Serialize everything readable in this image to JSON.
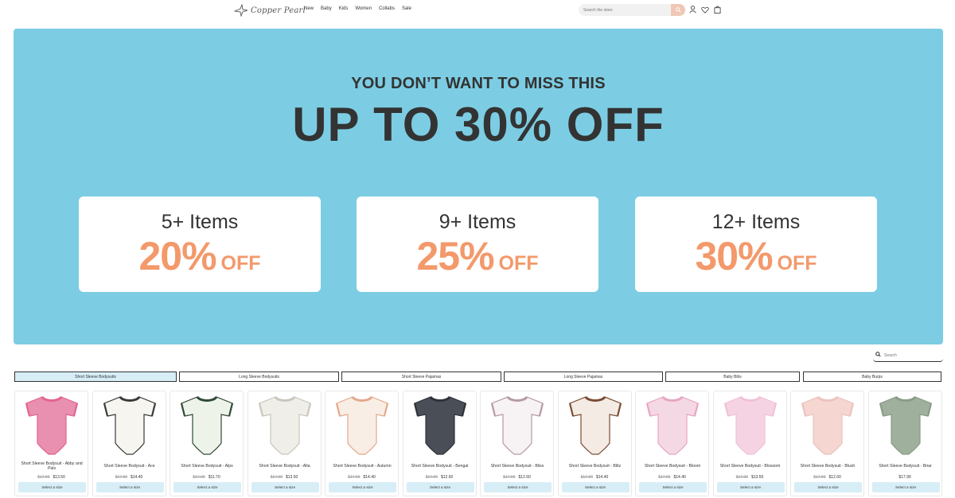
{
  "header": {
    "logo_text": "Copper Pearl",
    "nav": [
      "New",
      "Baby",
      "Kids",
      "Women",
      "Collabs",
      "Sale"
    ],
    "search_placeholder": "Search the store"
  },
  "hero": {
    "kicker": "YOU DON’T WANT TO MISS THIS",
    "headline": "UP TO 30% OFF",
    "tiers": [
      {
        "items": "5+ Items",
        "percent": "20%",
        "off": "OFF"
      },
      {
        "items": "9+ Items",
        "percent": "25%",
        "off": "OFF"
      },
      {
        "items": "12+ Items",
        "percent": "30%",
        "off": "OFF"
      }
    ],
    "background_color": "#7ccde3",
    "discount_color": "#f3996b"
  },
  "product_search": {
    "placeholder": "Search"
  },
  "tabs": [
    {
      "label": "Short Sleeve Bodysuits",
      "active": true
    },
    {
      "label": "Long Sleeve Bodysuits",
      "active": false
    },
    {
      "label": "Short Sleeve Pajamas",
      "active": false
    },
    {
      "label": "Long Sleeve Pajamas",
      "active": false
    },
    {
      "label": "Baby Bibs",
      "active": false
    },
    {
      "label": "Baby Burps",
      "active": false
    }
  ],
  "products": [
    {
      "name": "Short Sleeve Bodysuit - Abby and Pals",
      "old_price": "$17.99",
      "price": "$13.50",
      "button": "Select a size",
      "color": "#e98fb0",
      "trim": "#e2648f"
    },
    {
      "name": "Short Sleeve Bodysuit - Ace",
      "old_price": "$17.99",
      "price": "$14.40",
      "button": "Select a size",
      "color": "#f7f5f0",
      "trim": "#3a3a3a"
    },
    {
      "name": "Short Sleeve Bodysuit - Alps",
      "old_price": "$17.99",
      "price": "$11.70",
      "button": "Select a size",
      "color": "#eef3ea",
      "trim": "#2f4a35"
    },
    {
      "name": "Short Sleeve Bodysuit - Alta",
      "old_price": "$17.99",
      "price": "$13.50",
      "button": "Select a size",
      "color": "#efeee8",
      "trim": "#c9c6bb"
    },
    {
      "name": "Short Sleeve Bodysuit - Autumn",
      "old_price": "$17.99",
      "price": "$14.40",
      "button": "Select a size",
      "color": "#f8eee6",
      "trim": "#e3a98a"
    },
    {
      "name": "Short Sleeve Bodysuit - Bengal",
      "old_price": "$17.99",
      "price": "$12.60",
      "button": "Select a size",
      "color": "#4a4f57",
      "trim": "#2e3238"
    },
    {
      "name": "Short Sleeve Bodysuit - Bliss",
      "old_price": "$17.99",
      "price": "$12.60",
      "button": "Select a size",
      "color": "#f7f2f4",
      "trim": "#b59aa4"
    },
    {
      "name": "Short Sleeve Bodysuit - Blitz",
      "old_price": "$17.99",
      "price": "$14.40",
      "button": "Select a size",
      "color": "#f3ebe4",
      "trim": "#7b4d33"
    },
    {
      "name": "Short Sleeve Bodysuit - Bloom",
      "old_price": "$17.99",
      "price": "$14.40",
      "button": "Select a size",
      "color": "#f4d9e4",
      "trim": "#e8a5c1"
    },
    {
      "name": "Short Sleeve Bodysuit - Blossom",
      "old_price": "$17.99",
      "price": "$13.50",
      "button": "Select a size",
      "color": "#f6d3e2",
      "trim": "#f0c2d6"
    },
    {
      "name": "Short Sleeve Bodysuit - Blush",
      "old_price": "$17.99",
      "price": "$12.60",
      "button": "Select a size",
      "color": "#f5d6d1",
      "trim": "#ecc3bd"
    },
    {
      "name": "Short Sleeve Bodysuit - Briar",
      "old_price": "",
      "price": "$17.99",
      "button": "Select a size",
      "color": "#9fb09c",
      "trim": "#8a9c87"
    }
  ]
}
